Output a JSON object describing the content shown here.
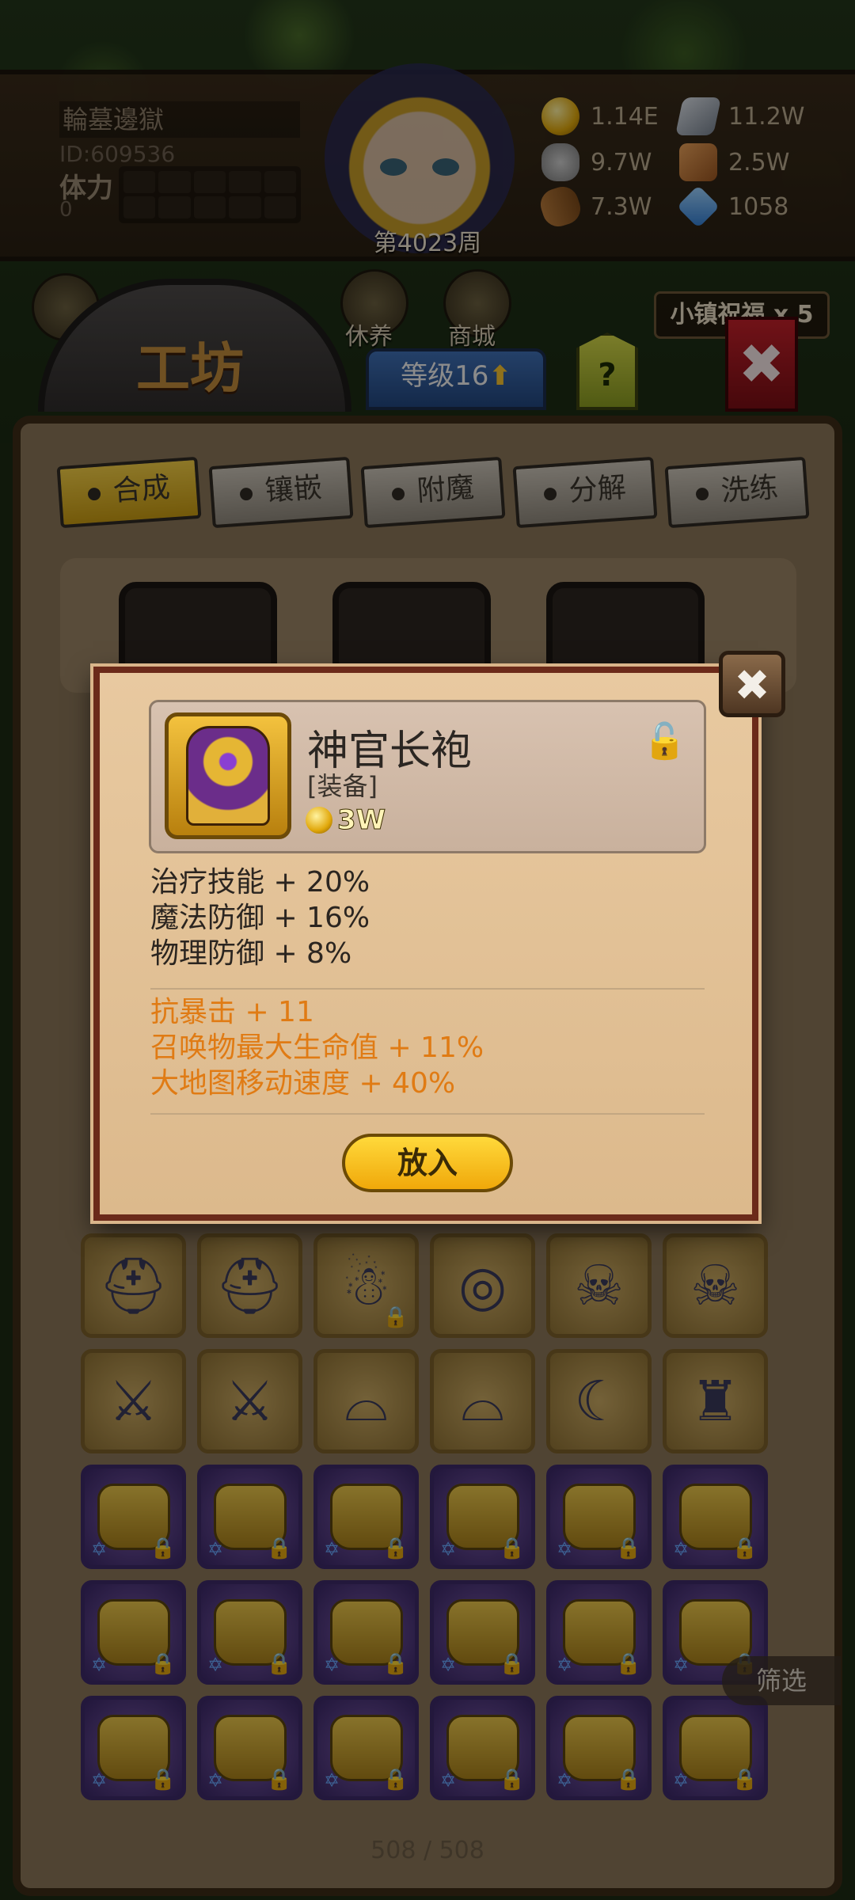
{
  "header": {
    "player_name": "輪墓邊獄",
    "player_id": "ID:609536",
    "stamina_label": "体力",
    "stamina_value": "0",
    "week": "第4023周"
  },
  "resources": [
    {
      "icon": "gold-coin-icon",
      "value": "1.14E"
    },
    {
      "icon": "iron-ingot-icon",
      "value": "11.2W"
    },
    {
      "icon": "stone-icon",
      "value": "9.7W"
    },
    {
      "icon": "leather-icon",
      "value": "2.5W"
    },
    {
      "icon": "wood-log-icon",
      "value": "7.3W"
    },
    {
      "icon": "crystal-icon",
      "value": "1058"
    }
  ],
  "nav": {
    "workshop_title": "工坊",
    "rest_label": "休养",
    "shop_label": "商城",
    "level_label": "等级16",
    "help_label": "?",
    "blessing_label": "小镇祝福 x 5",
    "close_label": "✖"
  },
  "tabs": [
    "合成",
    "镶嵌",
    "附魔",
    "分解",
    "洗练"
  ],
  "popup": {
    "close_label": "✖",
    "item_name": "神官长袍",
    "item_type": "[装备]",
    "price": "3W",
    "base_stats": [
      "治疗技能 + 20%",
      "魔法防御 + 16%",
      "物理防御 + 8%"
    ],
    "extra_stats": [
      "抗暴击 + 11",
      "召唤物最大生命值 + 11%",
      "大地图移动速度 + 40%"
    ],
    "put_button": "放入"
  },
  "inventory": {
    "filter_label": "筛选",
    "capacity": "508 / 508"
  },
  "colors": {
    "accent_gold": "#f0a80a",
    "extra_stat_orange": "#e07b14",
    "popup_border": "#6b2a1a"
  }
}
